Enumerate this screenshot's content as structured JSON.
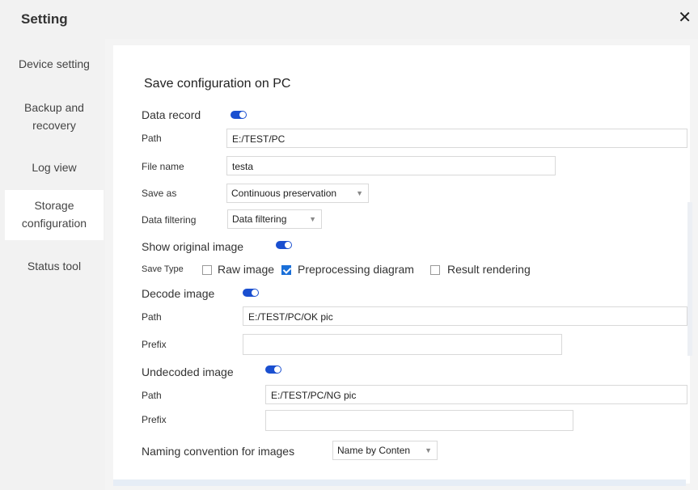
{
  "window": {
    "title": "Setting",
    "close_icon": "close-icon"
  },
  "sidebar": {
    "items": [
      {
        "label": "Device setting"
      },
      {
        "label_line1": "Backup and",
        "label_line2": "recovery"
      },
      {
        "label": "Log view"
      },
      {
        "label_line1": "Storage",
        "label_line2": "configuration",
        "active": true
      },
      {
        "label": "Status tool"
      }
    ]
  },
  "main": {
    "section_title": "Save configuration on PC",
    "data_record": {
      "label": "Data record",
      "enabled": true
    },
    "path": {
      "label": "Path",
      "value": "E:/TEST/PC"
    },
    "file_name": {
      "label": "File name",
      "value": "testa"
    },
    "save_as": {
      "label": "Save as",
      "selected": "Continuous preservation"
    },
    "data_filtering": {
      "label": "Data filtering",
      "selected": "Data filtering"
    },
    "show_original_image": {
      "label": "Show original image",
      "enabled": true
    },
    "save_type": {
      "label": "Save Type",
      "options": [
        {
          "label": "Raw image",
          "checked": false
        },
        {
          "label": "Preprocessing diagram",
          "checked": true
        },
        {
          "label": "Result rendering",
          "checked": false
        }
      ]
    },
    "decode_image": {
      "label": "Decode image",
      "enabled": true,
      "path_label": "Path",
      "path_value": "E:/TEST/PC/OK pic",
      "prefix_label": "Prefix",
      "prefix_value": ""
    },
    "undecoded_image": {
      "label": "Undecoded image",
      "enabled": true,
      "path_label": "Path",
      "path_value": "E:/TEST/PC/NG pic",
      "prefix_label": "Prefix",
      "prefix_value": ""
    },
    "naming_convention": {
      "label": "Naming convention for images",
      "selected": "Name by Conten"
    }
  },
  "colors": {
    "accent": "#1a4fd0",
    "sidebar_bg": "#f2f2f2",
    "checkbox_checked": "#1a6fd8"
  }
}
